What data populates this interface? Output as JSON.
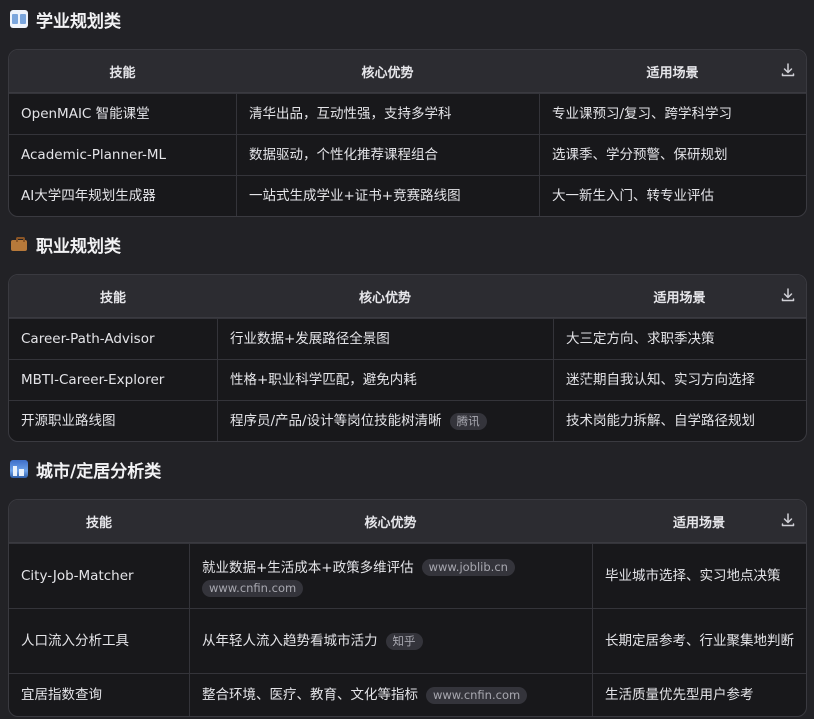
{
  "sections": [
    {
      "title": "学业规划类",
      "icon": "open-book-icon",
      "headers": [
        "技能",
        "核心优势",
        "适用场景"
      ],
      "rows": [
        {
          "skill": "OpenMAIC 智能课堂",
          "advantage": "清华出品，互动性强，支持多学科",
          "scene": "专业课预习/复习、跨学科学习"
        },
        {
          "skill": "Academic-Planner-ML",
          "advantage": "数据驱动，个性化推荐课程组合",
          "scene": "选课季、学分预警、保研规划"
        },
        {
          "skill": "AI大学四年规划生成器",
          "advantage": "一站式生成学业+证书+竞赛路线图",
          "scene": "大一新生入门、转专业评估"
        }
      ]
    },
    {
      "title": "职业规划类",
      "icon": "briefcase-icon",
      "headers": [
        "技能",
        "核心优势",
        "适用场景"
      ],
      "rows": [
        {
          "skill": "Career-Path-Advisor",
          "advantage": "行业数据+发展路径全景图",
          "scene": "大三定方向、求职季决策"
        },
        {
          "skill": "MBTI-Career-Explorer",
          "advantage": "性格+职业科学匹配，避免内耗",
          "scene": "迷茫期自我认知、实习方向选择"
        },
        {
          "skill": "开源职业路线图",
          "advantage": "程序员/产品/设计等岗位技能树清晰",
          "cite": "腾讯",
          "scene": "技术岗能力拆解、自学路径规划"
        }
      ]
    },
    {
      "title": "城市/定居分析类",
      "icon": "cityscape-icon",
      "headers": [
        "技能",
        "核心优势",
        "适用场景"
      ],
      "rows": [
        {
          "skill": "City-Job-Matcher",
          "advantage": "就业数据+生活成本+政策多维评估",
          "cite": "www.joblib.cn",
          "cite2": "www.cnfin.com",
          "scene": "毕业城市选择、实习地点决策"
        },
        {
          "skill": "人口流入分析工具",
          "advantage": "从年轻人流入趋势看城市活力",
          "cite": "知乎",
          "scene": "长期定居参考、行业聚集地判断"
        },
        {
          "skill": "宜居指数查询",
          "advantage": "整合环境、医疗、教育、文化等指标",
          "cite": "www.cnfin.com",
          "scene": "生活质量优先型用户参考"
        }
      ]
    }
  ],
  "colors": {
    "page_bg": "#222226",
    "table_bg": "#18181b",
    "header_bg": "#2c2c31",
    "border": "#3a3a40",
    "text": "#e4e4e8",
    "cite_bg": "#34343b"
  }
}
